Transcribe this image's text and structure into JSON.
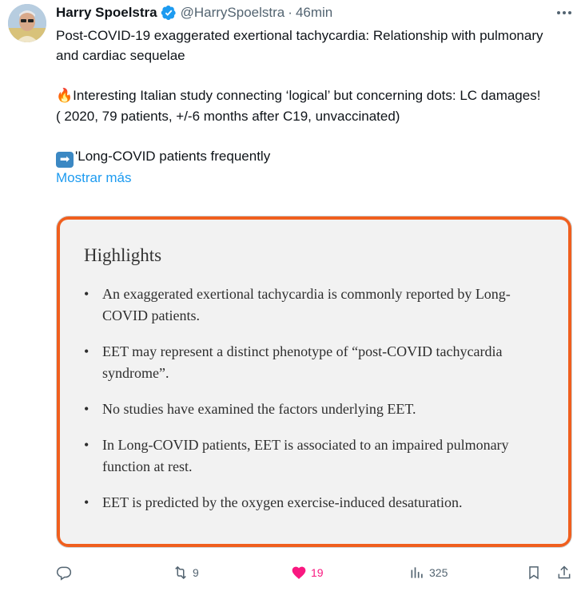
{
  "tweet": {
    "author_name": "Harry Spoelstra",
    "handle": "@HarrySpoelstra",
    "separator": "·",
    "time": "46min",
    "text_line1": "Post-COVID-19 exaggerated exertional tachycardia: Relationship with pulmonary and cardiac sequelae",
    "text_line2": "Interesting Italian study connecting ‘logical’ but concerning dots: LC damages!",
    "text_line3": "( 2020, 79 patients, +/-6 months after C19, unvaccinated)",
    "text_line4": "'Long-COVID patients frequently",
    "show_more": "Mostrar más",
    "emoji_fire": "🔥",
    "emoji_arrow": "➡"
  },
  "media": {
    "border_color": "#f05f1e",
    "title": "Highlights",
    "items": [
      "An exaggerated exertional tachycardia is commonly reported by Long-COVID patients.",
      "EET may represent a distinct phenotype of “post-COVID tachycardia syndrome”.",
      "No studies have examined the factors underlying EET.",
      "In Long-COVID patients, EET is associated to an impaired pulmonary function at rest.",
      "EET is predicted by the oxygen exercise-induced desaturation."
    ]
  },
  "actions": {
    "reply_icon": "reply-icon",
    "retweet_count": "9",
    "like_count": "19",
    "views_count": "325",
    "like_color": "#f91880"
  }
}
